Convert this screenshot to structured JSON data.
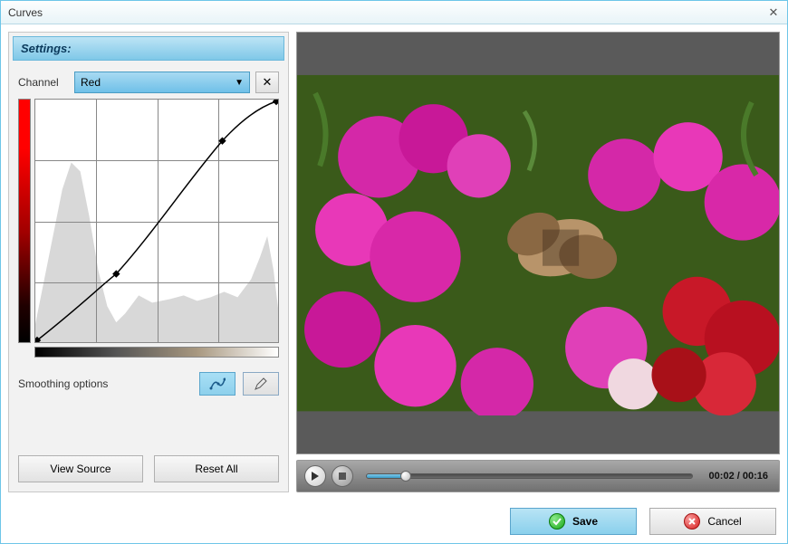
{
  "window": {
    "title": "Curves"
  },
  "settings": {
    "header": "Settings:",
    "channel_label": "Channel",
    "channel_value": "Red",
    "smoothing_label": "Smoothing options",
    "view_source_label": "View Source",
    "reset_all_label": "Reset All"
  },
  "player": {
    "current_time": "00:02",
    "total_time": "00:16",
    "separator": " / "
  },
  "footer": {
    "save_label": "Save",
    "cancel_label": "Cancel"
  },
  "colors": {
    "accent": "#7fc8e8",
    "channel_color": "#ff0000"
  },
  "curve": {
    "points": [
      {
        "x": 0.0,
        "y": 0.0
      },
      {
        "x": 0.33,
        "y": 0.28
      },
      {
        "x": 0.77,
        "y": 0.83
      },
      {
        "x": 1.0,
        "y": 1.0
      }
    ]
  }
}
